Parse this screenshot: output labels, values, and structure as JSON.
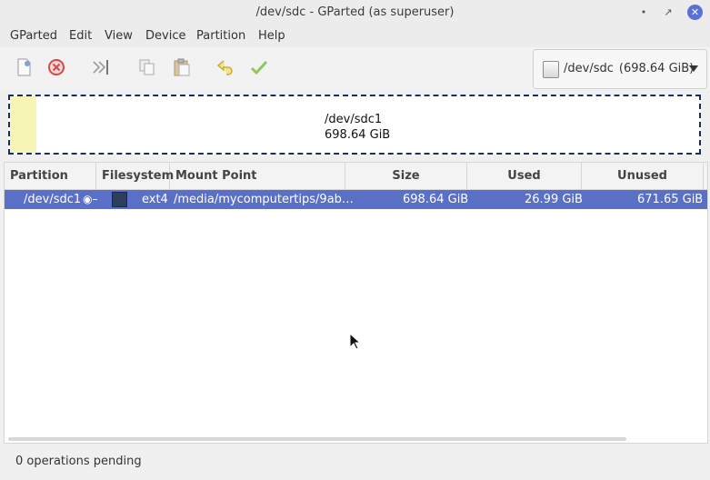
{
  "window": {
    "title": "/dev/sdc - GParted (as superuser)"
  },
  "menubar": {
    "items": [
      "GParted",
      "Edit",
      "View",
      "Device",
      "Partition",
      "Help"
    ]
  },
  "toolbar": {
    "icons": [
      "new-partition-icon",
      "delete-icon",
      "resize-move-icon",
      "copy-icon",
      "paste-icon",
      "undo-icon",
      "apply-icon"
    ]
  },
  "device_selector": {
    "device": "/dev/sdc",
    "size": "(698.64 GiB)"
  },
  "graph": {
    "partition": "/dev/sdc1",
    "size": "698.64 GiB",
    "colors": {
      "used": "#f7f5b6",
      "border": "#1b2e5c"
    }
  },
  "table": {
    "headers": [
      "Partition",
      "Filesystem",
      "Mount Point",
      "Size",
      "Used",
      "Unused"
    ],
    "rows": [
      {
        "partition": "/dev/sdc1",
        "filesystem": "ext4",
        "mount_point": "/media/mycomputertips/9ab…",
        "size": "698.64 GiB",
        "used": "26.99 GiB",
        "unused": "671.65 GiB"
      }
    ]
  },
  "status": {
    "text": "0 operations pending"
  },
  "colors": {
    "selection": "#5a70c6",
    "ext4": "#2e3d5c",
    "close_button": "#5b6fd6"
  }
}
